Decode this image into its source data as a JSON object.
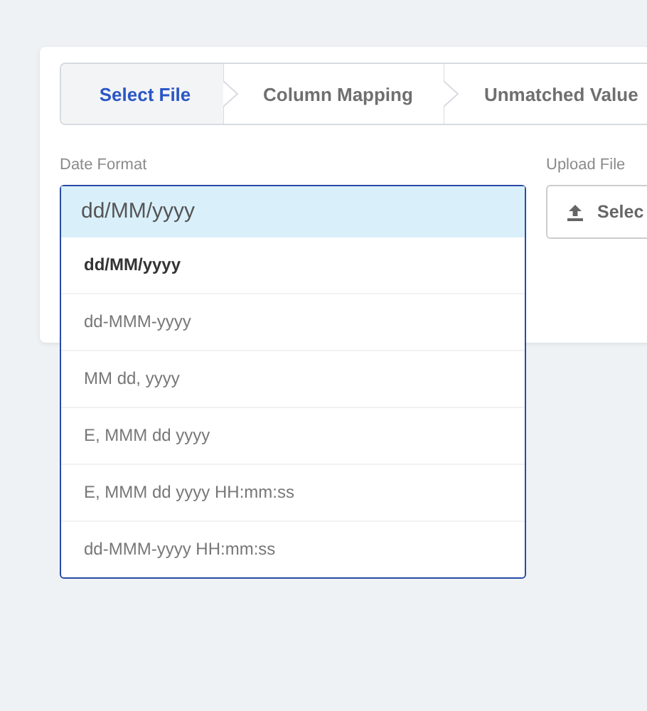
{
  "steps": [
    {
      "label": "Select File",
      "selected": true
    },
    {
      "label": "Column Mapping",
      "selected": false
    },
    {
      "label": "Unmatched Value",
      "selected": false
    }
  ],
  "date_format": {
    "label": "Date Format",
    "value": "dd/MM/yyyy",
    "expanded": true,
    "options": [
      {
        "label": "dd/MM/yyyy",
        "selected": true
      },
      {
        "label": "dd-MMM-yyyy",
        "selected": false
      },
      {
        "label": "MM dd, yyyy",
        "selected": false
      },
      {
        "label": "E, MMM dd yyyy",
        "selected": false
      },
      {
        "label": "E, MMM dd yyyy HH:mm:ss",
        "selected": false
      },
      {
        "label": "dd-MMM-yyyy HH:mm:ss",
        "selected": false
      }
    ]
  },
  "upload": {
    "label": "Upload File",
    "button": "Selec"
  }
}
